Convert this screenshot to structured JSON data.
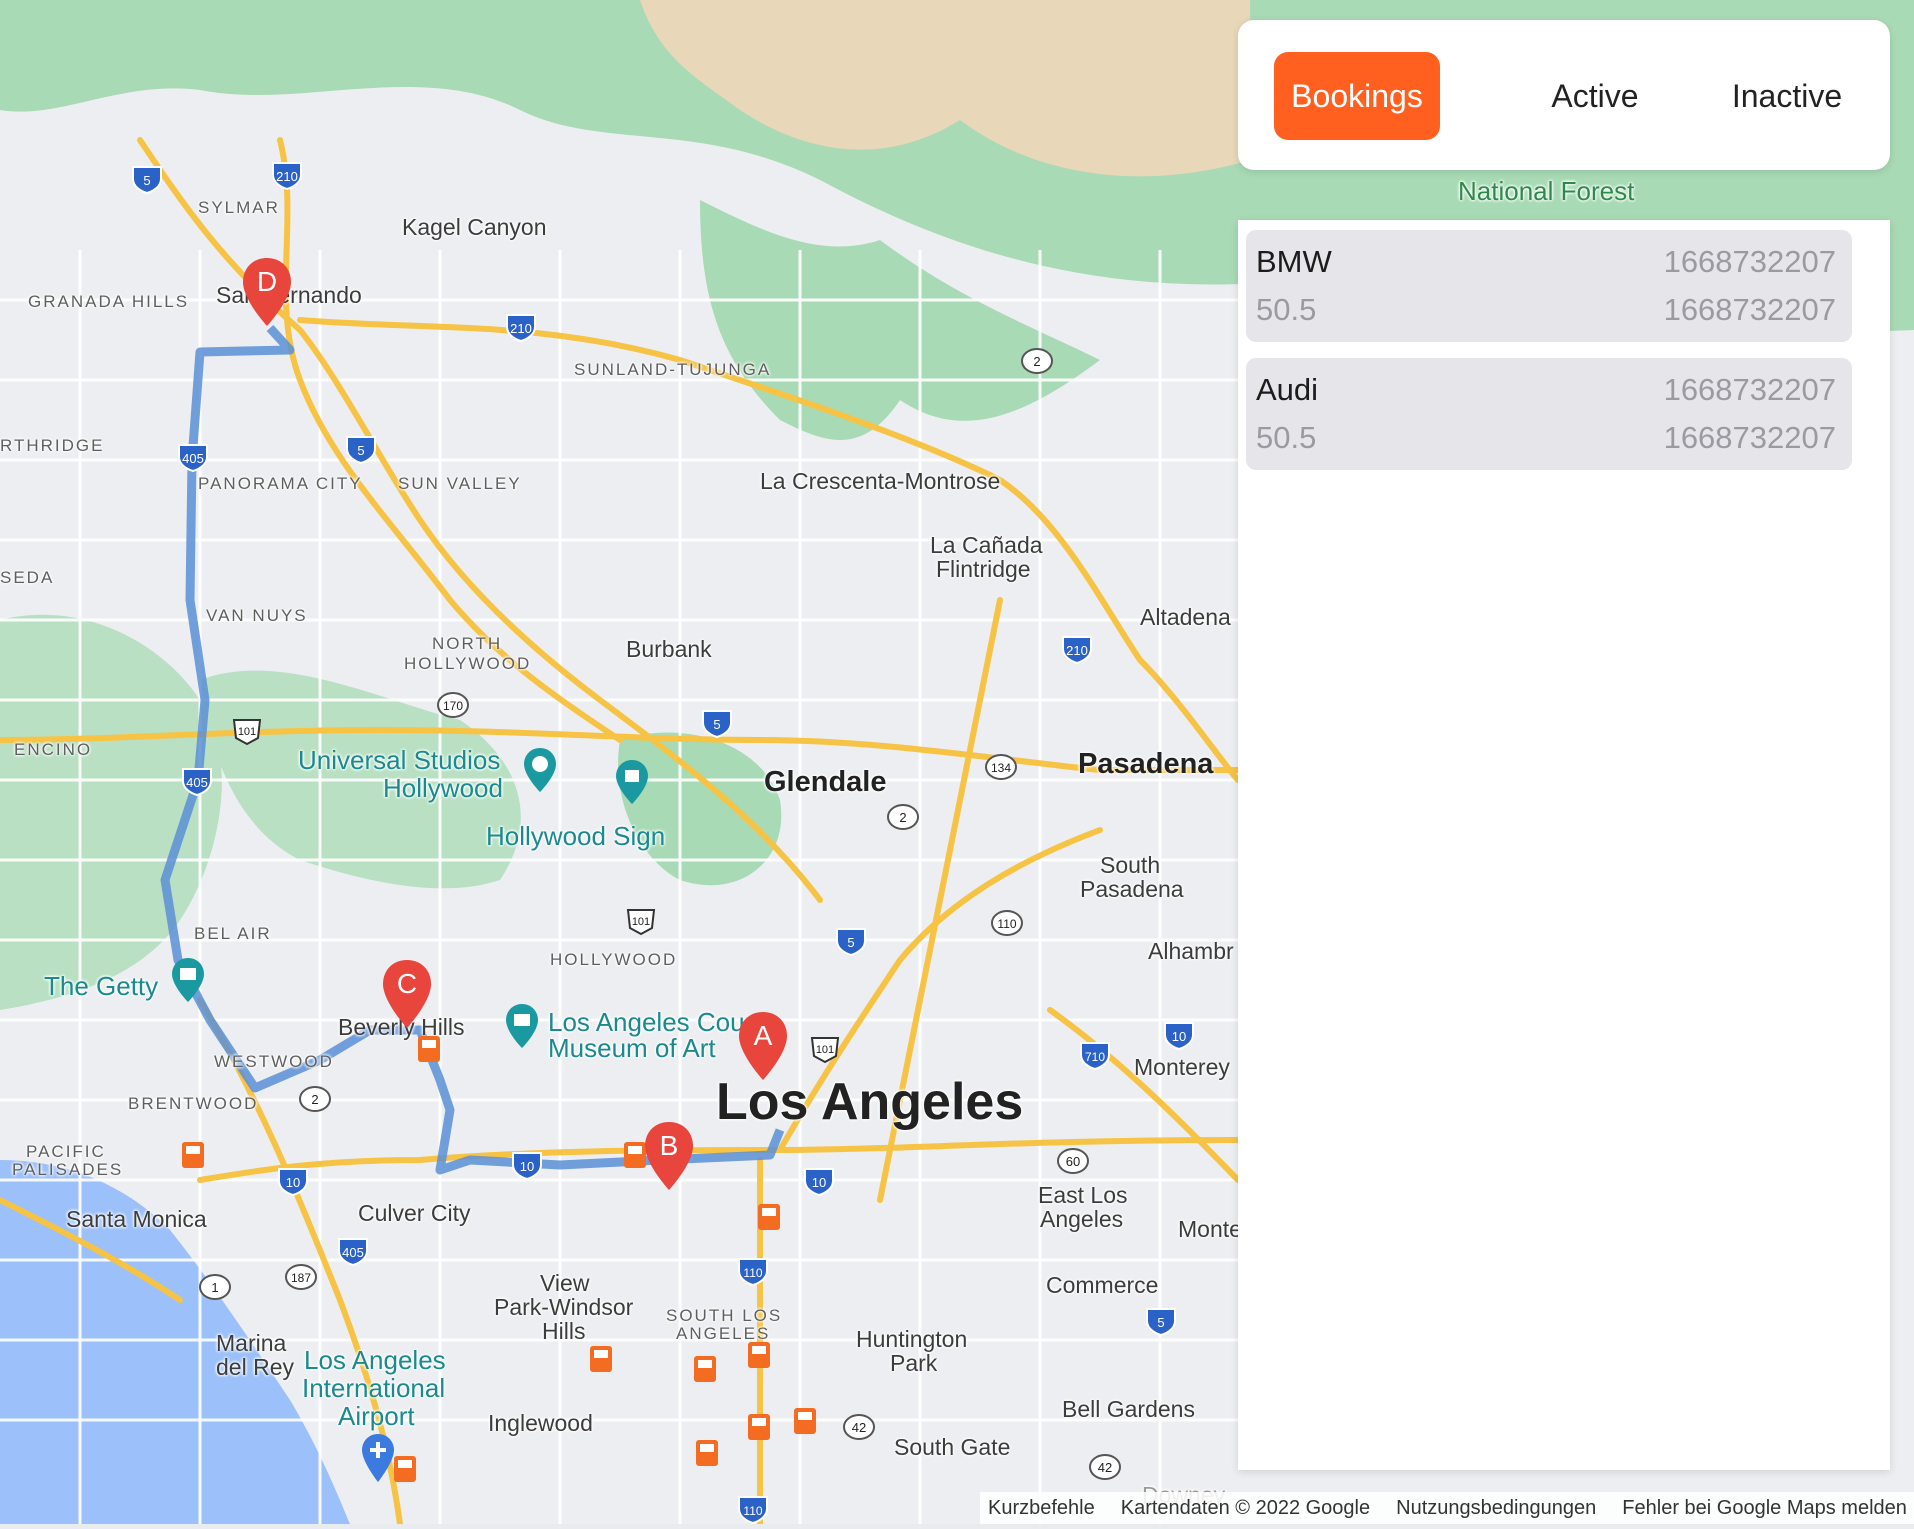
{
  "tabs": {
    "bookings_label": "Bookings",
    "active_label": "Active",
    "inactive_label": "Inactive"
  },
  "bookings": [
    {
      "name": "BMW",
      "price": "50.5",
      "timestamp_1": "1668732207",
      "timestamp_2": "1668732207"
    },
    {
      "name": "Audi",
      "price": "50.5",
      "timestamp_1": "1668732207",
      "timestamp_2": "1668732207"
    }
  ],
  "map": {
    "markers": {
      "a": "A",
      "b": "B",
      "c": "C",
      "d": "D"
    },
    "labels": {
      "sylmar": "SYLMAR",
      "kagel_canyon": "Kagel Canyon",
      "granada_hills": "GRANADA HILLS",
      "san_fernando": "San Fernando",
      "northridge": "RTHRIDGE",
      "panorama_city": "PANORAMA CITY",
      "sun_valley": "SUN VALLEY",
      "sunland_tujunga": "SUNLAND-TUJUNGA",
      "la_crescenta": "La Crescenta-Montrose",
      "la_canada_1": "La Cañada",
      "la_canada_2": "Flintridge",
      "reseda": "SEDA",
      "van_nuys": "VAN NUYS",
      "north_hollywood_1": "NORTH",
      "north_hollywood_2": "HOLLYWOOD",
      "burbank": "Burbank",
      "altadena": "Altadena",
      "encino": "ENCINO",
      "universal_1": "Universal Studios",
      "universal_2": "Hollywood",
      "hollywood_sign": "Hollywood Sign",
      "glendale": "Glendale",
      "pasadena": "Pasadena",
      "south_pasadena_1": "South",
      "south_pasadena_2": "Pasadena",
      "bel_air": "BEL AIR",
      "hollywood": "HOLLYWOOD",
      "alhambra": "Alhambr",
      "the_getty": "The Getty",
      "beverly_hills": "Beverly Hills",
      "lacma_1": "Los Angeles County",
      "lacma_2": "Museum of Art",
      "westwood": "WESTWOOD",
      "monterey": "Monterey",
      "los_angeles": "Los Angeles",
      "brentwood": "BRENTWOOD",
      "pacific_1": "PACIFIC",
      "pacific_2": "PALISADES",
      "east_la_1": "East Los",
      "east_la_2": "Angeles",
      "santa_monica": "Santa Monica",
      "culver_city": "Culver City",
      "monte": "Monte",
      "view_park_1": "View",
      "view_park_2": "Park-Windsor",
      "view_park_3": "Hills",
      "south_la_1": "SOUTH LOS",
      "south_la_2": "ANGELES",
      "commerce": "Commerce",
      "marina_1": "Marina",
      "marina_2": "del Rey",
      "lax_1": "Los Angeles",
      "lax_2": "International",
      "lax_3": "Airport",
      "huntington_1": "Huntington",
      "huntington_2": "Park",
      "inglewood": "Inglewood",
      "bell_gardens": "Bell Gardens",
      "south_gate": "South Gate",
      "national_forest": "National Forest",
      "downey": "Downey"
    },
    "shields": {
      "i5a": "5",
      "i210a": "210",
      "i210b": "210",
      "i405a": "405",
      "i5b": "5",
      "r2a": "2",
      "r170": "170",
      "r101a": "101",
      "i405b": "405",
      "i5c": "5",
      "r134": "134",
      "r2b": "2",
      "i210c": "210",
      "r101b": "101",
      "i5d": "5",
      "r110a": "110",
      "i710": "710",
      "i10a": "10",
      "r101c": "101",
      "r2c": "2",
      "i10b": "10",
      "i10c": "10",
      "i10d": "10",
      "r60": "60",
      "i405c": "405",
      "r187": "187",
      "r1": "1",
      "i110": "110",
      "i5e": "5",
      "r42a": "42",
      "r42b": "42",
      "i110b": "110"
    }
  },
  "footer": {
    "shortcuts": "Kurzbefehle",
    "map_data": "Kartendaten © 2022 Google",
    "terms": "Nutzungsbedingungen",
    "report": "Fehler bei Google Maps melden"
  },
  "colors": {
    "accent": "#ff6020",
    "route": "#5b8fd6",
    "pin": "#e8453c",
    "water": "#9cc0f9",
    "park": "#a8dab5",
    "mountain": "#e8d7b9"
  }
}
